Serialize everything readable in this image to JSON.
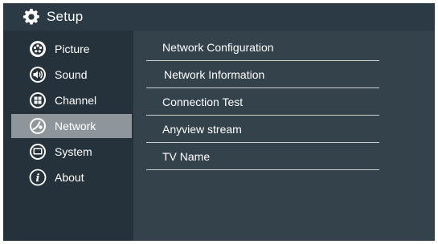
{
  "header": {
    "title": "Setup",
    "icon": "gear-icon"
  },
  "sidebar": {
    "items": [
      {
        "label": "Picture",
        "icon": "picture-icon",
        "selected": false
      },
      {
        "label": "Sound",
        "icon": "speaker-icon",
        "selected": false
      },
      {
        "label": "Channel",
        "icon": "channel-grid-icon",
        "selected": false
      },
      {
        "label": "Network",
        "icon": "network-icon",
        "selected": true
      },
      {
        "label": "System",
        "icon": "system-icon",
        "selected": false
      },
      {
        "label": "About",
        "icon": "info-icon",
        "selected": false
      }
    ]
  },
  "network_menu": {
    "items": [
      {
        "label": "Network Configuration"
      },
      {
        "label": "Network Information"
      },
      {
        "label": "Connection Test"
      },
      {
        "label": "Anyview stream"
      },
      {
        "label": "TV Name"
      }
    ]
  },
  "colors": {
    "header_bg": "#2b3a44",
    "sidebar_bg": "#25323b",
    "main_bg": "#34424b",
    "selected_bg": "#8f969b",
    "text": "#ffffff",
    "divider": "#c9ced1"
  }
}
